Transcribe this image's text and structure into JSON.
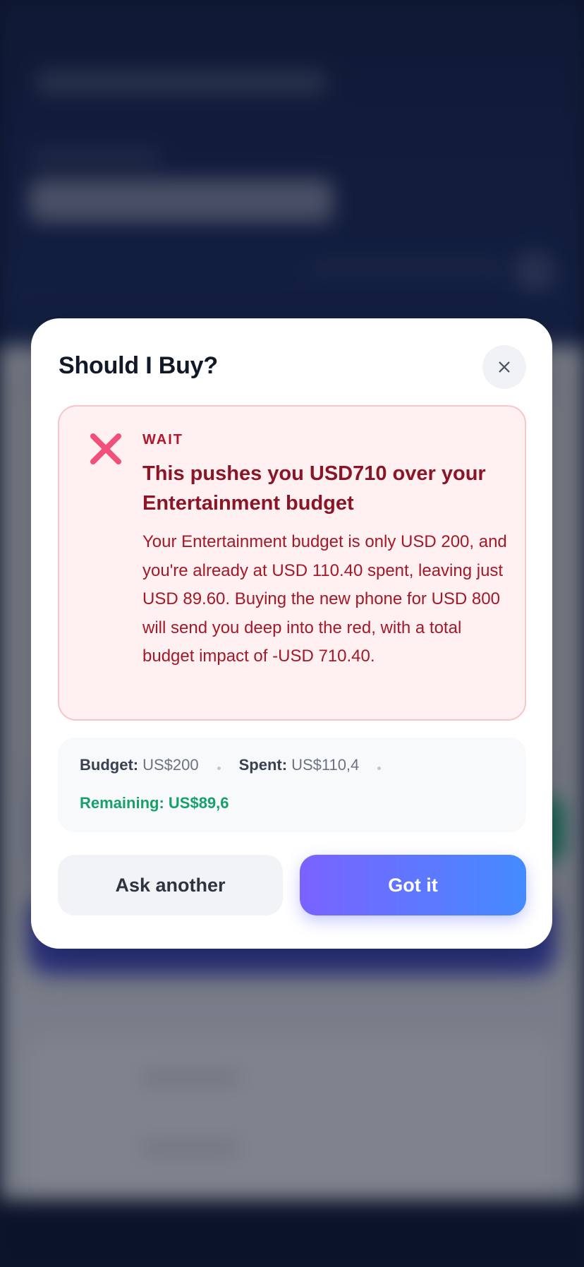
{
  "modal": {
    "title": "Should I Buy?",
    "close_icon": "close-icon"
  },
  "alert": {
    "icon": "x-mark-icon",
    "label": "WAIT",
    "headline": "This pushes you USD710 over your Entertainment budget",
    "body": "Your Entertainment budget is only USD 200, and you're already at USD 110.40 spent, leaving just USD 89.60. Buying the new phone for USD 800 will send you deep into the red, with a total budget impact of -USD 710.40.",
    "colors": {
      "accent": "#f0507a",
      "text": "#8a1526",
      "bg": "#fff0f1"
    }
  },
  "stats": {
    "budget_label": "Budget:",
    "budget_value": "US$200",
    "spent_label": "Spent:",
    "spent_value": "US$110,4",
    "remaining": "Remaining: US$89,6",
    "remaining_color": "#16a06a"
  },
  "actions": {
    "secondary_label": "Ask another",
    "primary_label": "Got it"
  }
}
